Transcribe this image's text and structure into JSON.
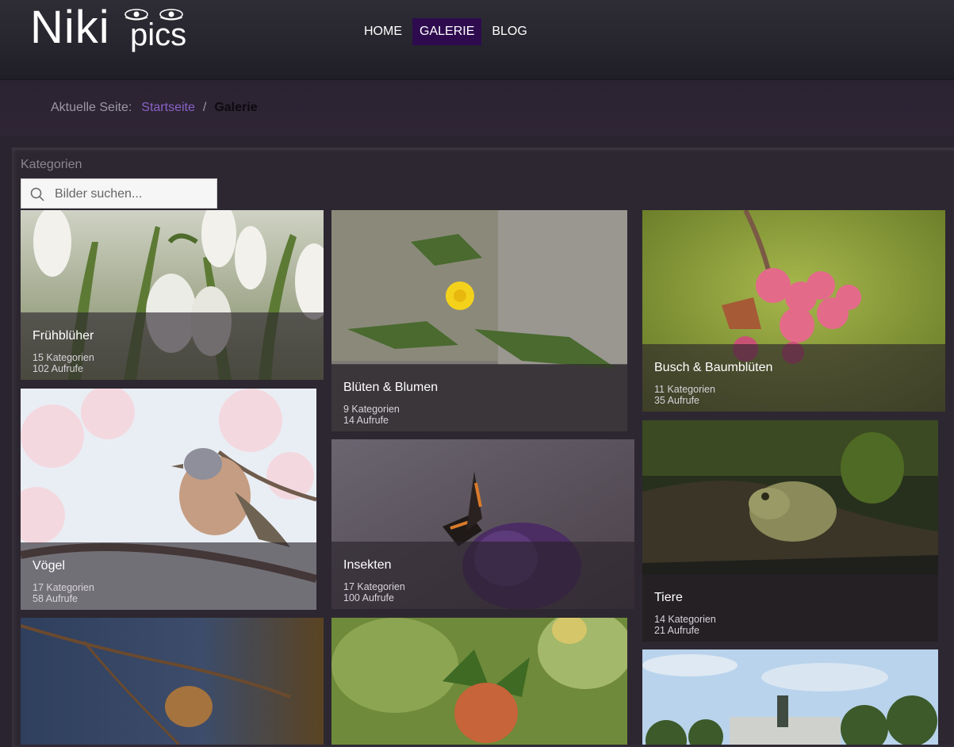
{
  "brand": {
    "name_big": "Niki",
    "name_small": "pics"
  },
  "nav": [
    {
      "label": "HOME",
      "active": false
    },
    {
      "label": "GALERIE",
      "active": true
    },
    {
      "label": "BLOG",
      "active": false
    }
  ],
  "breadcrumb": {
    "prefix": "Aktuelle Seite:",
    "home": "Startseite",
    "separator": "/",
    "current": "Galerie"
  },
  "gallery": {
    "section_title": "Kategorien",
    "search_placeholder": "Bilder suchen...",
    "cards": [
      {
        "title": "Frühblüher",
        "categories": "15 Kategorien",
        "views": "102 Aufrufe"
      },
      {
        "title": "Blüten & Blumen",
        "categories": "9 Kategorien",
        "views": "14 Aufrufe"
      },
      {
        "title": "Busch & Baumblüten",
        "categories": "11 Kategorien",
        "views": "35 Aufrufe"
      },
      {
        "title": "Vögel",
        "categories": "17 Kategorien",
        "views": "58 Aufrufe"
      },
      {
        "title": "Insekten",
        "categories": "17 Kategorien",
        "views": "100 Aufrufe"
      },
      {
        "title": "Tiere",
        "categories": "14 Kategorien",
        "views": "21 Aufrufe"
      }
    ]
  },
  "colors": {
    "nav_active": "#2e0b4f",
    "link": "#8b62c7",
    "background": "#2a2430"
  }
}
